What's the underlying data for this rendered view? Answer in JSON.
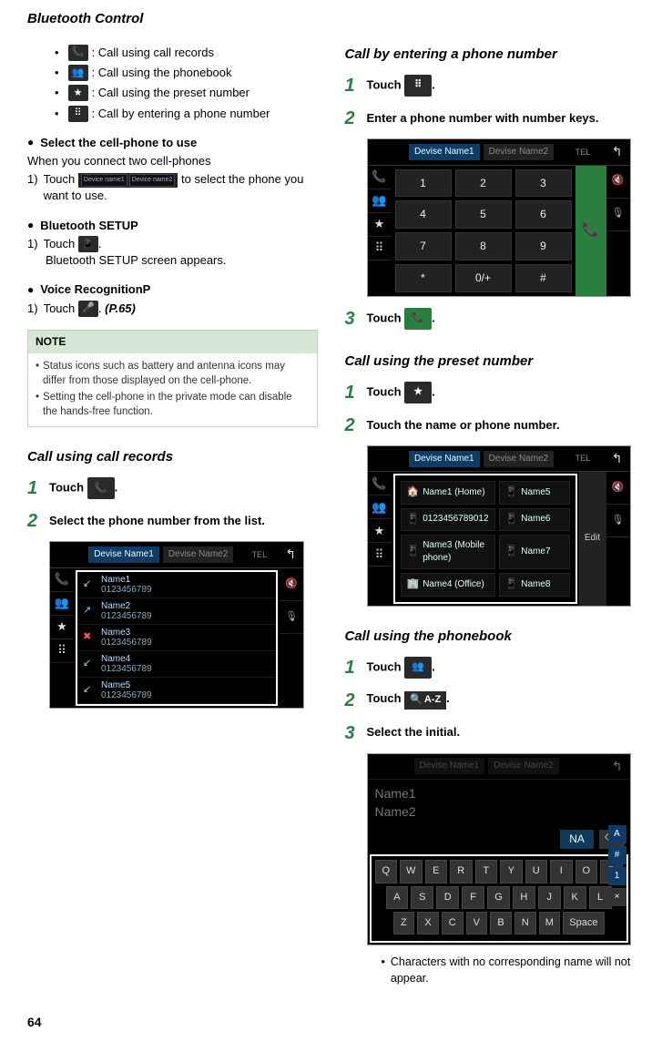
{
  "page_title": "Bluetooth Control",
  "page_number": "64",
  "intro_list": [
    {
      "icon": "call-records-icon",
      "glyph": "📞",
      "text": ": Call using call records"
    },
    {
      "icon": "phonebook-icon",
      "glyph": "👥",
      "text": ": Call using the phonebook"
    },
    {
      "icon": "preset-star-icon",
      "glyph": "★",
      "text": ": Call using the preset number"
    },
    {
      "icon": "dialpad-icon",
      "glyph": "⋮⋮",
      "text": ": Call by entering a phone number"
    }
  ],
  "select_phone": {
    "heading": "Select the cell-phone to use",
    "line": "When you connect two cell-phones",
    "step_prefix": "1)",
    "step_a": "Touch",
    "device1": "Device name1",
    "device2": "Device name2",
    "step_b": "to select the phone you want to use."
  },
  "bt_setup": {
    "heading": "Bluetooth SETUP",
    "step_prefix": "1)",
    "step_a": "Touch",
    "glyph": "⚙",
    "after": ".",
    "line2": "Bluetooth SETUP screen appears."
  },
  "voice": {
    "heading": "Voice RecognitionP",
    "step_prefix": "1)",
    "step_a": "Touch",
    "glyph": "🎤",
    "after": ".",
    "ref": "(P.65)"
  },
  "note": {
    "title": "NOTE",
    "items": [
      "Status icons such as battery and antenna icons may differ from those displayed on the cell-phone.",
      "Setting the cell-phone in the private mode can disable the hands-free function."
    ]
  },
  "call_records": {
    "heading": "Call using call records",
    "step1": "Touch",
    "step1_after": ".",
    "step2": "Select the phone number from the list.",
    "shot": {
      "dev1": "Devise Name1",
      "dev2": "Devise Name2",
      "tel": "TEL",
      "items": [
        {
          "name": "Name1",
          "num": "0123456789"
        },
        {
          "name": "Name2",
          "num": "0123456789"
        },
        {
          "name": "Name3",
          "num": "0123456789"
        },
        {
          "name": "Name4",
          "num": "0123456789"
        },
        {
          "name": "Name5",
          "num": "0123456789"
        }
      ]
    }
  },
  "call_by_number": {
    "heading": "Call by entering a phone number",
    "step1": "Touch",
    "step1_after": ".",
    "step2": "Enter a phone number with number keys.",
    "step3": "Touch",
    "step3_after": ".",
    "shot": {
      "dev1": "Devise Name1",
      "dev2": "Devise Name2",
      "keys": [
        "1",
        "2",
        "3",
        "4",
        "5",
        "6",
        "7",
        "8",
        "9",
        "*",
        "0/+",
        "#"
      ]
    }
  },
  "call_preset": {
    "heading": "Call using the preset number",
    "step1": "Touch",
    "step1_after": ".",
    "step2": "Touch the name or phone number.",
    "shot": {
      "dev1": "Devise Name1",
      "dev2": "Devise Name2",
      "cells": [
        "Name1 (Home)",
        "Name5",
        "0123456789012",
        "Name6",
        "Name3 (Mobile phone)",
        "Name7",
        "Name4 (Office)",
        "Name8"
      ],
      "edit": "Edit"
    }
  },
  "call_phonebook": {
    "heading": "Call using the phonebook",
    "step1": "Touch",
    "step1_after": ".",
    "step2": "Touch",
    "az_label": "A-Z",
    "step2_after": ".",
    "step3": "Select the initial.",
    "shot": {
      "dev1": "Devise Name1",
      "dev2": "Devise Name2",
      "names": [
        "Name1",
        "Name2"
      ],
      "input": "NA",
      "row1": [
        "Q",
        "W",
        "E",
        "R",
        "T",
        "Y",
        "U",
        "I",
        "O",
        "P"
      ],
      "row2": [
        "A",
        "S",
        "D",
        "F",
        "G",
        "H",
        "J",
        "K",
        "L"
      ],
      "row3": [
        "Z",
        "X",
        "C",
        "V",
        "B",
        "N",
        "M",
        "Space"
      ],
      "side": [
        "A",
        "#",
        "1",
        "×"
      ]
    },
    "footnote": "Characters with no corresponding name will not appear."
  }
}
